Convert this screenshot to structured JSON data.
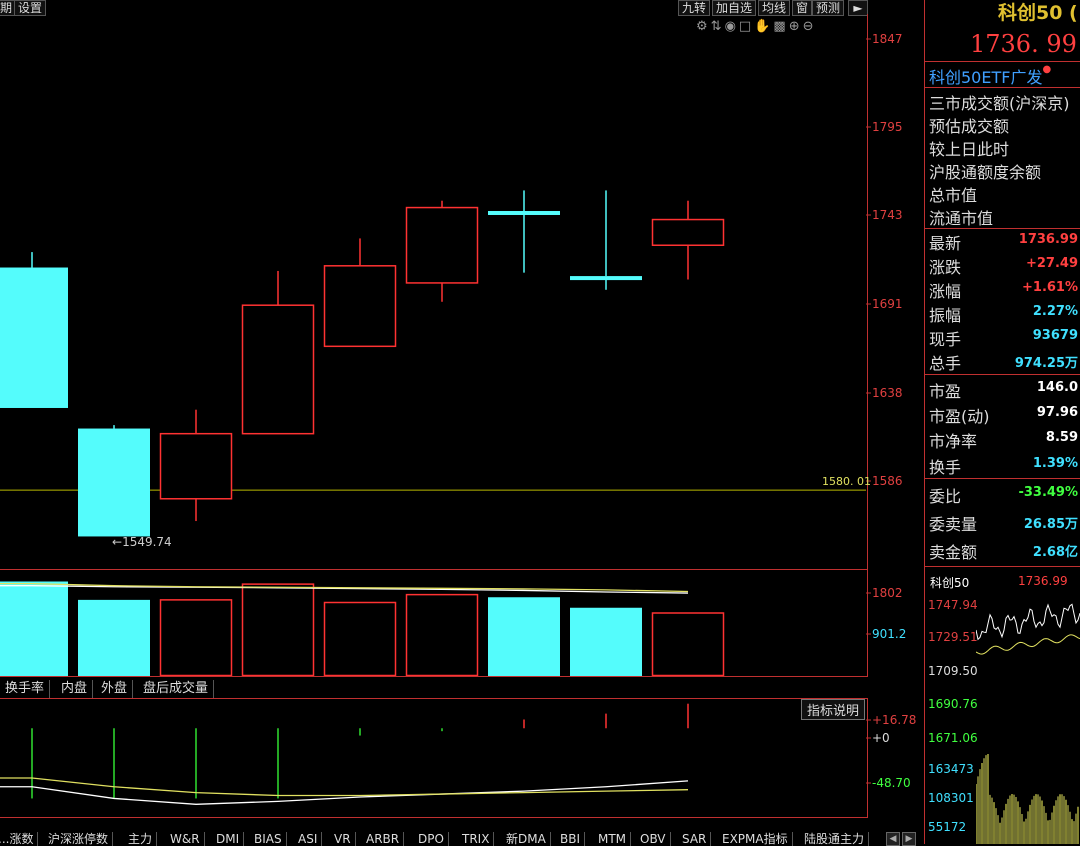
{
  "toolbar": {
    "left_partial_1": "期",
    "left_settings": "设置",
    "buttons": [
      "九转",
      "加自选",
      "均线",
      "窗",
      "预测"
    ],
    "arrow_icon": "right-arrow-icon"
  },
  "header": {
    "title": "科创50 (",
    "price": "1736. 99",
    "etf_label": "科创50ETF广发"
  },
  "main_axis": [
    "1847",
    "1795",
    "1743",
    "1691",
    "1638",
    "1586"
  ],
  "ref_line_label": "1580. 01",
  "low_marker": "1549.74",
  "chart_data": [
    {
      "type": "candlestick",
      "y_range": [
        1534,
        1858
      ],
      "ref_line": 1580.01,
      "low_annotation": 1549.74,
      "candles": [
        {
          "open": 1710,
          "close": 1628,
          "high": 1719,
          "low": 1628,
          "color": "cyan"
        },
        {
          "open": 1616,
          "close": 1553,
          "high": 1618,
          "low": 1553,
          "color": "cyan"
        },
        {
          "open": 1575,
          "close": 1613,
          "high": 1627,
          "low": 1562,
          "color": "red"
        },
        {
          "open": 1613,
          "close": 1688,
          "high": 1708,
          "low": 1613,
          "color": "red"
        },
        {
          "open": 1664,
          "close": 1711,
          "high": 1727,
          "low": 1664,
          "color": "red"
        },
        {
          "open": 1701,
          "close": 1745,
          "high": 1749,
          "low": 1690,
          "color": "red"
        },
        {
          "open": 1743,
          "close": 1741,
          "high": 1755,
          "low": 1707,
          "color": "cyan"
        },
        {
          "open": 1705,
          "close": 1704,
          "high": 1755,
          "low": 1697,
          "color": "cyan"
        },
        {
          "open": 1723,
          "close": 1738,
          "high": 1749,
          "low": 1703,
          "color": "red"
        }
      ]
    },
    {
      "type": "bar",
      "y_range": [
        0,
        2000
      ],
      "values": [
        1800,
        1450,
        1450,
        1750,
        1400,
        1550,
        1500,
        1300,
        1200
      ],
      "colors": [
        "cyan",
        "cyan",
        "red",
        "red",
        "red",
        "red",
        "cyan",
        "cyan",
        "red"
      ],
      "ma_white": [
        1720,
        1700,
        1690,
        1680,
        1665,
        1650,
        1630,
        1600,
        1580
      ],
      "ma_yellow": [
        1760,
        1720,
        1700,
        1690,
        1680,
        1670,
        1660,
        1640,
        1610
      ]
    },
    {
      "type": "bar",
      "y_range": [
        -60,
        20
      ],
      "values": [
        -48,
        -48,
        -48,
        -48,
        -5,
        -2,
        6,
        10,
        16.78
      ],
      "line_white": [
        -40,
        -48,
        -52,
        -50,
        -47,
        -45,
        -43,
        -40,
        -36
      ],
      "line_yellow": [
        -34,
        -40,
        -44,
        -46,
        -46,
        -45,
        -44,
        -43,
        -42
      ]
    }
  ],
  "vol_axis": [
    "1802",
    "901.2"
  ],
  "indicator": {
    "button": "指标说明",
    "axis": [
      "+16.78",
      "+0",
      "-48.70"
    ]
  },
  "mid_tabs": [
    "换手率",
    "内盘",
    "外盘",
    "盘后成交量"
  ],
  "bottom_tabs": [
    "...涨数",
    "沪深涨停数",
    "主力",
    "W&R",
    "DMI",
    "BIAS",
    "ASI",
    "VR",
    "ARBR",
    "DPO",
    "TRIX",
    "新DMA",
    "BBI",
    "MTM",
    "OBV",
    "SAR",
    "EXPMA指标",
    "陆股通主力"
  ],
  "right_panel": {
    "info_rows": [
      "三市成交额(沪深京)",
      "预估成交额",
      "较上日此时",
      "沪股通额度余额",
      "总市值",
      "流通市值"
    ],
    "quote_rows": [
      {
        "label": "最新",
        "value": "1736.99",
        "color": "#ff4040"
      },
      {
        "label": "涨跌",
        "value": "+27.49",
        "color": "#ff4040"
      },
      {
        "label": "涨幅",
        "value": "+1.61%",
        "color": "#ff4040"
      },
      {
        "label": "振幅",
        "value": "2.27%",
        "color": "#40e0ff"
      },
      {
        "label": "现手",
        "value": "93679",
        "color": "#40e0ff"
      },
      {
        "label": "总手",
        "value": "974.25万",
        "color": "#40e0ff"
      }
    ],
    "valuation_rows": [
      {
        "label": "市盈",
        "value": "146.0",
        "color": "#ffffff"
      },
      {
        "label": "市盈(动)",
        "value": "97.96",
        "color": "#ffffff"
      },
      {
        "label": "市净率",
        "value": "8.59",
        "color": "#ffffff"
      },
      {
        "label": "换手",
        "value": "1.39%",
        "color": "#40e0ff"
      }
    ],
    "order_rows": [
      {
        "label": "委比",
        "value": "-33.49%",
        "color": "#40ff40"
      },
      {
        "label": "委卖量",
        "value": "26.85万",
        "color": "#40e0ff"
      },
      {
        "label": "卖金额",
        "value": "2.68亿",
        "color": "#40e0ff"
      }
    ],
    "mini": {
      "name": "科创50",
      "price": "1736.99",
      "axis": [
        "1747.94",
        "1729.51",
        "1709.50",
        "1690.76",
        "1671.06",
        "163473",
        "108301",
        "55172"
      ]
    }
  }
}
